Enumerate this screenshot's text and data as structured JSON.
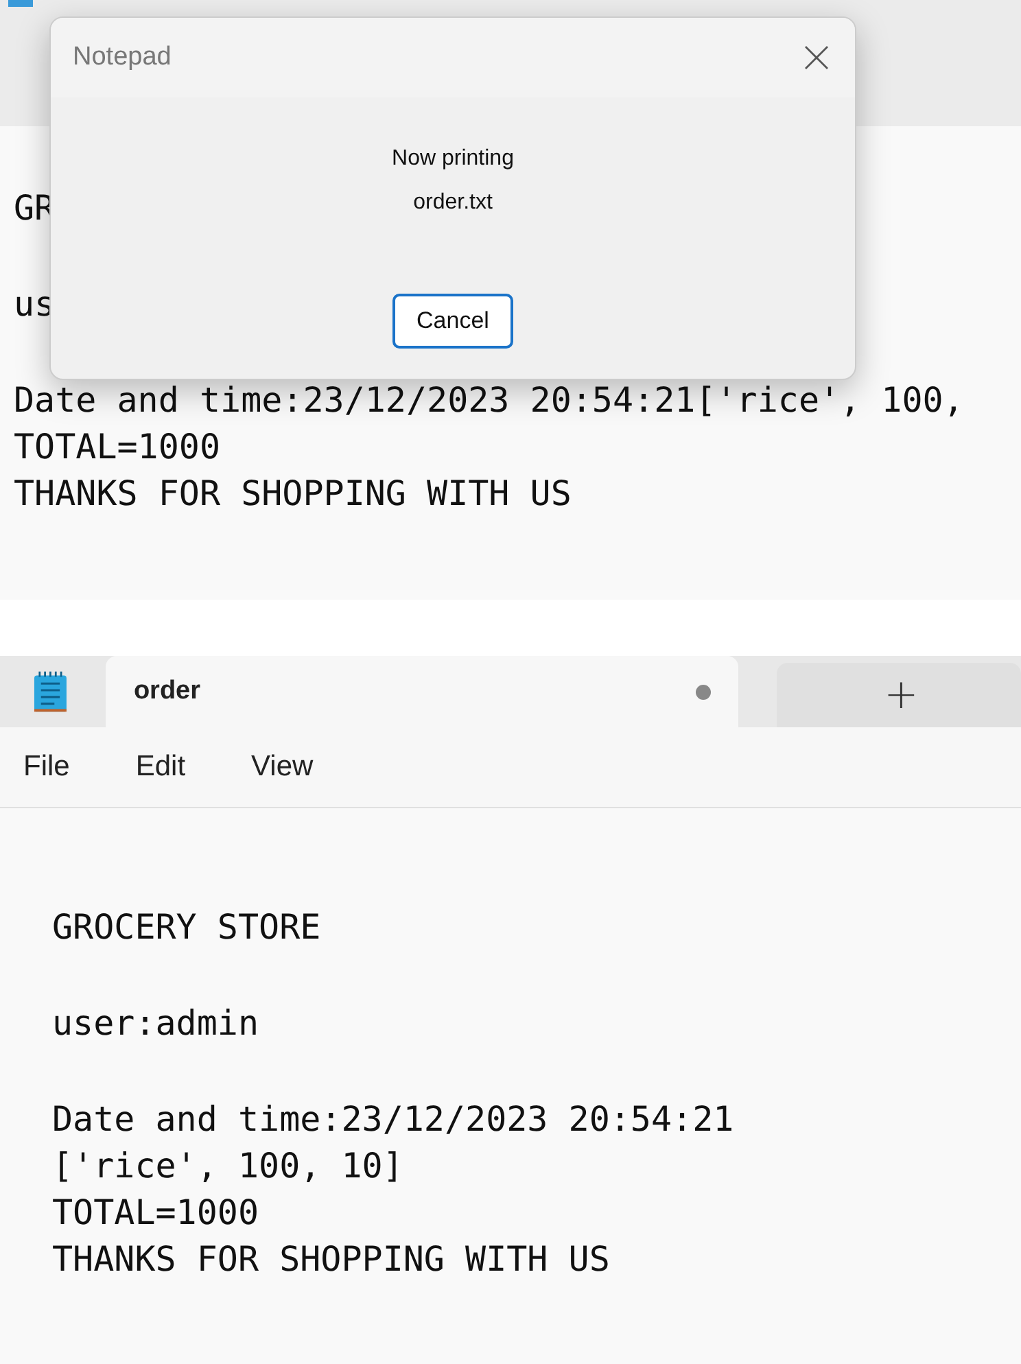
{
  "background_window": {
    "paragraphs": [
      [
        "GR"
      ],
      [
        "us"
      ],
      [
        "Date and time:23/12/2023 20:54:21['rice', 100,",
        "TOTAL=1000",
        "THANKS FOR SHOPPING WITH US"
      ]
    ]
  },
  "print_dialog": {
    "title": "Notepad",
    "message": [
      "Now printing",
      "order.txt"
    ],
    "button": "Cancel"
  },
  "notepad_window": {
    "tabs": [
      {
        "title": "order",
        "selected": true,
        "modified": true
      }
    ],
    "new_tab": "+",
    "menu": [
      "File",
      "Edit",
      "View"
    ],
    "paragraphs": [
      [
        "GROCERY STORE"
      ],
      [
        "user:admin"
      ],
      [
        "Date and time:23/12/2023 20:54:21",
        "['rice', 100, 10]",
        "TOTAL=1000",
        "THANKS FOR SHOPPING WITH US"
      ]
    ]
  }
}
